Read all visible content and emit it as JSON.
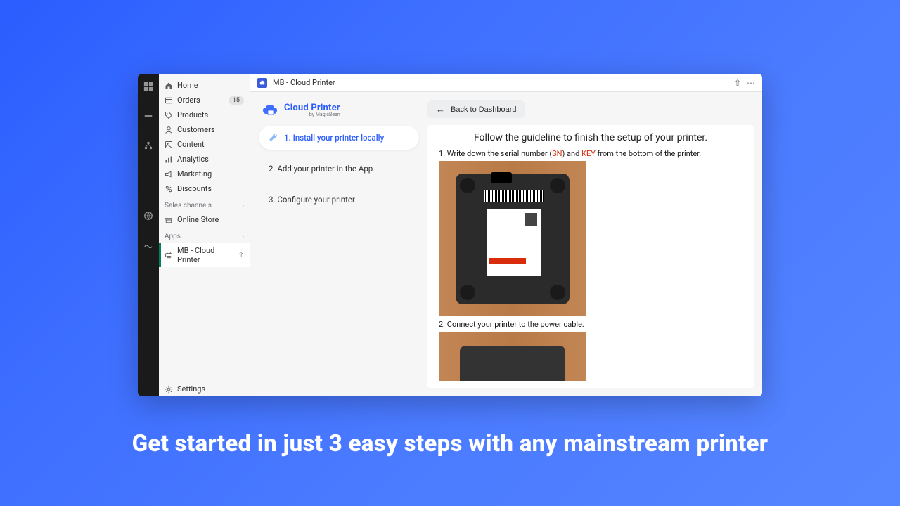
{
  "sidebar": {
    "items": [
      {
        "label": "Home"
      },
      {
        "label": "Orders",
        "badge": "15"
      },
      {
        "label": "Products"
      },
      {
        "label": "Customers"
      },
      {
        "label": "Content"
      },
      {
        "label": "Analytics"
      },
      {
        "label": "Marketing"
      },
      {
        "label": "Discounts"
      }
    ],
    "sales_channels_label": "Sales channels",
    "online_store_label": "Online Store",
    "apps_label": "Apps",
    "active_app_label": "MB - Cloud Printer",
    "settings_label": "Settings"
  },
  "topbar": {
    "title": "MB - Cloud Printer"
  },
  "brand": {
    "title": "Cloud Printer",
    "subtitle": "by MagicBean"
  },
  "steps": [
    {
      "label": "1. Install your printer locally",
      "active": true
    },
    {
      "label": "2. Add your printer in the App",
      "active": false
    },
    {
      "label": "3. Configure your printer",
      "active": false
    }
  ],
  "back_button": "Back to Dashboard",
  "guide": {
    "heading": "Follow the guideline to finish the setup of your printer.",
    "line1_pre": "1. Write down the serial number (",
    "line1_sn": "SN",
    "line1_mid": ") and ",
    "line1_key": "KEY",
    "line1_post": " from the bottom of the printer.",
    "line2": "2. Connect your printer to the power cable."
  },
  "hero_caption": "Get started in just 3 easy steps with any mainstream printer"
}
